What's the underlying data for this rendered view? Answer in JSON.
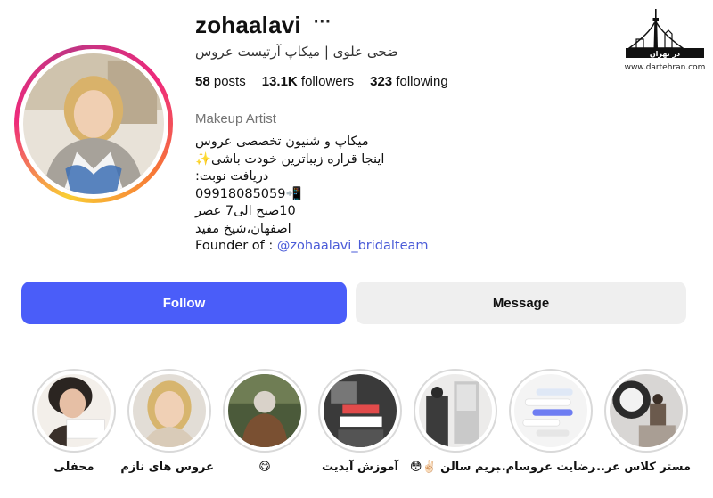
{
  "profile": {
    "username": "zohaalavi",
    "more_glyph": "···",
    "full_name": "ضحی علوی | میکاپ آرتیست عروس",
    "stats": {
      "posts_count": "58",
      "posts_label": "posts",
      "followers_count": "13.1K",
      "followers_label": "followers",
      "following_count": "323",
      "following_label": "following"
    },
    "category": "Makeup Artist",
    "bio": {
      "line1": "میکاپ و شنیون تخصصی عروس",
      "line2": "اینجا قراره زیباترین خودت باشی✨",
      "line3": "دریافت نوبت:",
      "line4": "09918085059📲",
      "line5": "10صبح الی7 عصر",
      "line6": "اصفهان،شیخ مفید",
      "founder_prefix": "Founder of : ",
      "founder_link": "@zohaalavi_bridalteam"
    }
  },
  "actions": {
    "follow_label": "Follow",
    "message_label": "Message"
  },
  "highlights": [
    {
      "label": "مستر کلاس عر..."
    },
    {
      "label": "رضایت عروسام..."
    },
    {
      "label": "بریم سالن ✌🏻😳"
    },
    {
      "label": "آموزش آیدیت"
    },
    {
      "label": "😋"
    },
    {
      "label": "عروس های نازم"
    },
    {
      "label": "محفلی"
    }
  ],
  "watermark": {
    "brand_text": "در تهران",
    "url": "www.dartehran.com"
  },
  "colors": {
    "follow_button": "#4a5df9",
    "message_button": "#efefef",
    "link": "#4a5bd8",
    "secondary_text": "#737373"
  }
}
